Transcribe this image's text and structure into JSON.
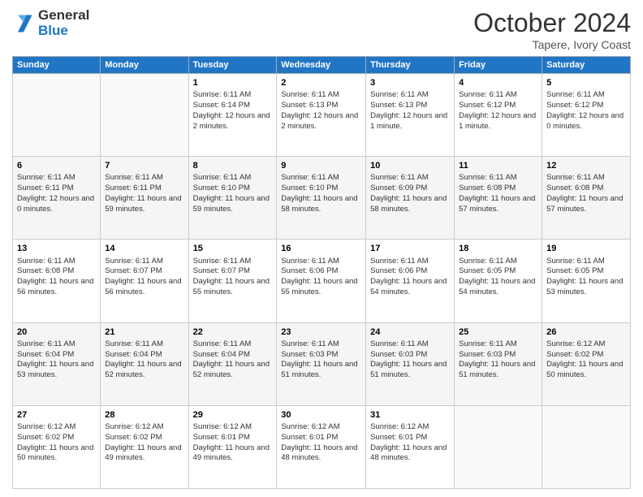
{
  "header": {
    "logo_line1": "General",
    "logo_line2": "Blue",
    "month": "October 2024",
    "location": "Tapere, Ivory Coast"
  },
  "days_of_week": [
    "Sunday",
    "Monday",
    "Tuesday",
    "Wednesday",
    "Thursday",
    "Friday",
    "Saturday"
  ],
  "weeks": [
    [
      {
        "day": "",
        "info": ""
      },
      {
        "day": "",
        "info": ""
      },
      {
        "day": "1",
        "info": "Sunrise: 6:11 AM\nSunset: 6:14 PM\nDaylight: 12 hours and 2 minutes."
      },
      {
        "day": "2",
        "info": "Sunrise: 6:11 AM\nSunset: 6:13 PM\nDaylight: 12 hours and 2 minutes."
      },
      {
        "day": "3",
        "info": "Sunrise: 6:11 AM\nSunset: 6:13 PM\nDaylight: 12 hours and 1 minute."
      },
      {
        "day": "4",
        "info": "Sunrise: 6:11 AM\nSunset: 6:12 PM\nDaylight: 12 hours and 1 minute."
      },
      {
        "day": "5",
        "info": "Sunrise: 6:11 AM\nSunset: 6:12 PM\nDaylight: 12 hours and 0 minutes."
      }
    ],
    [
      {
        "day": "6",
        "info": "Sunrise: 6:11 AM\nSunset: 6:11 PM\nDaylight: 12 hours and 0 minutes."
      },
      {
        "day": "7",
        "info": "Sunrise: 6:11 AM\nSunset: 6:11 PM\nDaylight: 11 hours and 59 minutes."
      },
      {
        "day": "8",
        "info": "Sunrise: 6:11 AM\nSunset: 6:10 PM\nDaylight: 11 hours and 59 minutes."
      },
      {
        "day": "9",
        "info": "Sunrise: 6:11 AM\nSunset: 6:10 PM\nDaylight: 11 hours and 58 minutes."
      },
      {
        "day": "10",
        "info": "Sunrise: 6:11 AM\nSunset: 6:09 PM\nDaylight: 11 hours and 58 minutes."
      },
      {
        "day": "11",
        "info": "Sunrise: 6:11 AM\nSunset: 6:08 PM\nDaylight: 11 hours and 57 minutes."
      },
      {
        "day": "12",
        "info": "Sunrise: 6:11 AM\nSunset: 6:08 PM\nDaylight: 11 hours and 57 minutes."
      }
    ],
    [
      {
        "day": "13",
        "info": "Sunrise: 6:11 AM\nSunset: 6:08 PM\nDaylight: 11 hours and 56 minutes."
      },
      {
        "day": "14",
        "info": "Sunrise: 6:11 AM\nSunset: 6:07 PM\nDaylight: 11 hours and 56 minutes."
      },
      {
        "day": "15",
        "info": "Sunrise: 6:11 AM\nSunset: 6:07 PM\nDaylight: 11 hours and 55 minutes."
      },
      {
        "day": "16",
        "info": "Sunrise: 6:11 AM\nSunset: 6:06 PM\nDaylight: 11 hours and 55 minutes."
      },
      {
        "day": "17",
        "info": "Sunrise: 6:11 AM\nSunset: 6:06 PM\nDaylight: 11 hours and 54 minutes."
      },
      {
        "day": "18",
        "info": "Sunrise: 6:11 AM\nSunset: 6:05 PM\nDaylight: 11 hours and 54 minutes."
      },
      {
        "day": "19",
        "info": "Sunrise: 6:11 AM\nSunset: 6:05 PM\nDaylight: 11 hours and 53 minutes."
      }
    ],
    [
      {
        "day": "20",
        "info": "Sunrise: 6:11 AM\nSunset: 6:04 PM\nDaylight: 11 hours and 53 minutes."
      },
      {
        "day": "21",
        "info": "Sunrise: 6:11 AM\nSunset: 6:04 PM\nDaylight: 11 hours and 52 minutes."
      },
      {
        "day": "22",
        "info": "Sunrise: 6:11 AM\nSunset: 6:04 PM\nDaylight: 11 hours and 52 minutes."
      },
      {
        "day": "23",
        "info": "Sunrise: 6:11 AM\nSunset: 6:03 PM\nDaylight: 11 hours and 51 minutes."
      },
      {
        "day": "24",
        "info": "Sunrise: 6:11 AM\nSunset: 6:03 PM\nDaylight: 11 hours and 51 minutes."
      },
      {
        "day": "25",
        "info": "Sunrise: 6:11 AM\nSunset: 6:03 PM\nDaylight: 11 hours and 51 minutes."
      },
      {
        "day": "26",
        "info": "Sunrise: 6:12 AM\nSunset: 6:02 PM\nDaylight: 11 hours and 50 minutes."
      }
    ],
    [
      {
        "day": "27",
        "info": "Sunrise: 6:12 AM\nSunset: 6:02 PM\nDaylight: 11 hours and 50 minutes."
      },
      {
        "day": "28",
        "info": "Sunrise: 6:12 AM\nSunset: 6:02 PM\nDaylight: 11 hours and 49 minutes."
      },
      {
        "day": "29",
        "info": "Sunrise: 6:12 AM\nSunset: 6:01 PM\nDaylight: 11 hours and 49 minutes."
      },
      {
        "day": "30",
        "info": "Sunrise: 6:12 AM\nSunset: 6:01 PM\nDaylight: 11 hours and 48 minutes."
      },
      {
        "day": "31",
        "info": "Sunrise: 6:12 AM\nSunset: 6:01 PM\nDaylight: 11 hours and 48 minutes."
      },
      {
        "day": "",
        "info": ""
      },
      {
        "day": "",
        "info": ""
      }
    ]
  ]
}
